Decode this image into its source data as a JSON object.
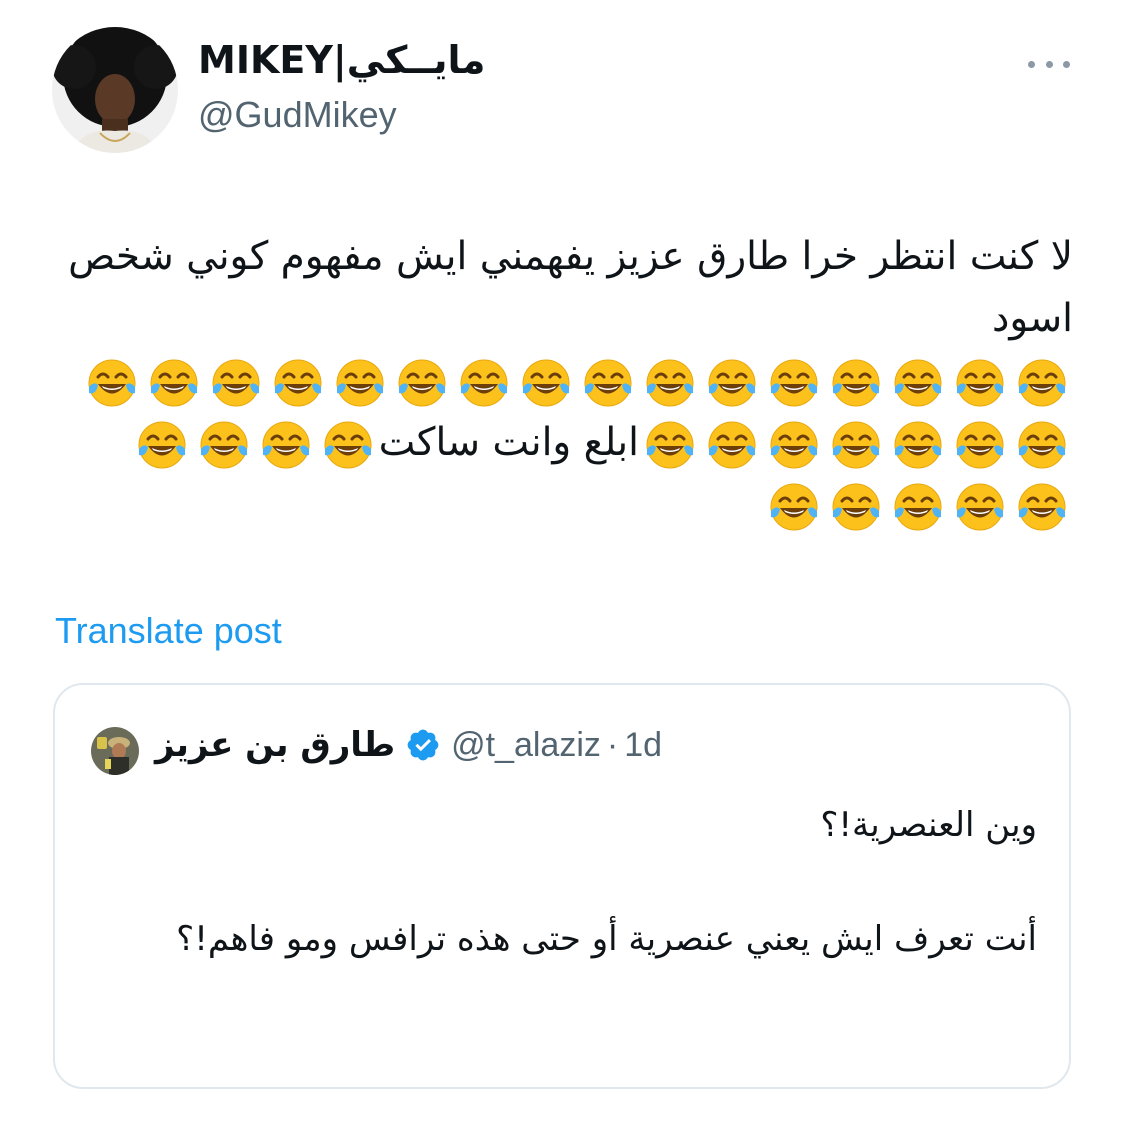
{
  "author": {
    "display_name": "MIKEY|مايــكي",
    "handle": "@GudMikey",
    "avatar_icon": "profile-photo"
  },
  "more_icon": "more-horizontal-icon",
  "tweet": {
    "text_line_1": "لا كنت انتظر خرا طارق عزيز يفهمني ايش مفهوم كوني شخص اسود",
    "emoji": "😂",
    "row1_emoji_count": 16,
    "row2_right_emoji_count": 7,
    "row2_text": "ابلع وانت ساكت",
    "row2_left_emoji_count": 4,
    "row3_emoji_count": 5
  },
  "translate_label": "Translate post",
  "quote": {
    "name": "طارق بن عزيز",
    "verified_icon": "verified-badge-icon",
    "handle": "@t_alaziz",
    "separator": "·",
    "time": "1d",
    "line_1": "وين العنصرية!؟",
    "line_2": "أنت تعرف ايش يعني عنصرية أو حتى هذه ترافس ومو فاهم!؟"
  },
  "colors": {
    "link_blue": "#1d9bf0",
    "secondary_text": "#536471",
    "verified_blue": "#1d9bf0",
    "border": "#e1e8ed"
  }
}
